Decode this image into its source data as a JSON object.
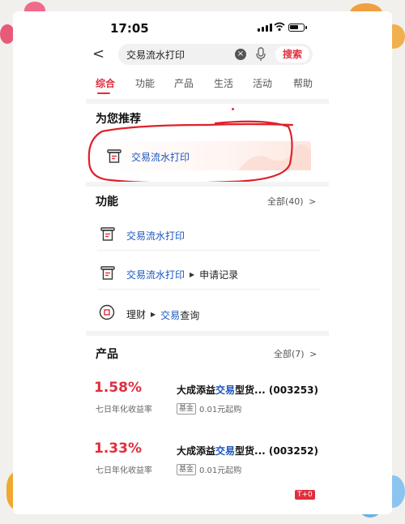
{
  "status_bar": {
    "time": "17:05"
  },
  "search": {
    "back": "<",
    "query": "交易流水打印",
    "clear": "×",
    "button": "搜索"
  },
  "tabs": [
    "综合",
    "功能",
    "产品",
    "生活",
    "活动",
    "帮助"
  ],
  "recommend": {
    "title": "为您推荐",
    "item": "交易流水打印"
  },
  "functions": {
    "title": "功能",
    "all": "全部(40)",
    "chevron": ">",
    "items": [
      {
        "label": "交易流水打印"
      },
      {
        "label": "交易流水打印",
        "sub": "申请记录"
      },
      {
        "prefix": "理财",
        "label": "交易",
        "suffix": "查询"
      }
    ]
  },
  "products": {
    "title": "产品",
    "all": "全部(7)",
    "chevron": ">",
    "items": [
      {
        "rate": "1.58%",
        "rate_label": "七日年化收益率",
        "name_a": "大成添益",
        "name_hl": "交易",
        "name_b": "型货... (003253)",
        "badge": "基金",
        "min": "0.01元起购"
      },
      {
        "rate": "1.33%",
        "rate_label": "七日年化收益率",
        "name_a": "大成添益",
        "name_hl": "交易",
        "name_b": "型货... (003252)",
        "badge": "基金",
        "min": "0.01元起购"
      }
    ],
    "corner_badge": "T+0"
  },
  "icons": [
    "back-icon",
    "clear-icon",
    "mic-icon",
    "document-icon",
    "circle-square-icon",
    "chevron-right-icon",
    "triangle-right-icon"
  ],
  "colors": {
    "accent": "#e02e3e",
    "link": "#1a56c0",
    "annotation": "#e0202a"
  }
}
